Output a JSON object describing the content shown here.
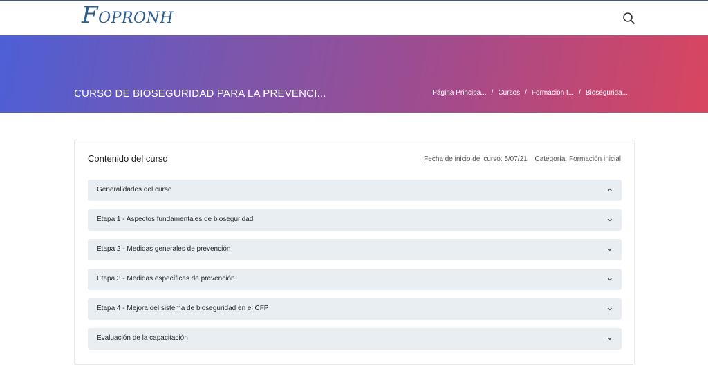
{
  "header": {
    "logo_initial": "F",
    "logo_rest": "OPRONH",
    "search_icon": "search-icon"
  },
  "hero": {
    "title": "CURSO DE BIOSEGURIDAD PARA LA PREVENCI...",
    "breadcrumb": [
      "Página Principa...",
      "Cursos",
      "Formación I...",
      "Bioseguridа..."
    ],
    "gradient": [
      "#4d5fd6",
      "#7a56ad",
      "#a24b8d",
      "#d9455f"
    ]
  },
  "course": {
    "heading": "Contenido del curso",
    "start_date": "Fecha de inicio del curso: 5/07/21",
    "category": "Categoría: Formación inicial",
    "sections": [
      {
        "label": "Generalidades del curso",
        "expanded": true
      },
      {
        "label": "Etapa 1 - Aspectos fundamentales de bioseguridad",
        "expanded": false
      },
      {
        "label": "Etapa 2 - Medidas generales de prevención",
        "expanded": false
      },
      {
        "label": "Etapa 3 - Medidas específicas de prevención",
        "expanded": false
      },
      {
        "label": "Etapa 4 - Mejora del sistema de bioseguridad en el CFP",
        "expanded": false
      },
      {
        "label": "Evaluación de la capacitación",
        "expanded": false
      }
    ]
  }
}
